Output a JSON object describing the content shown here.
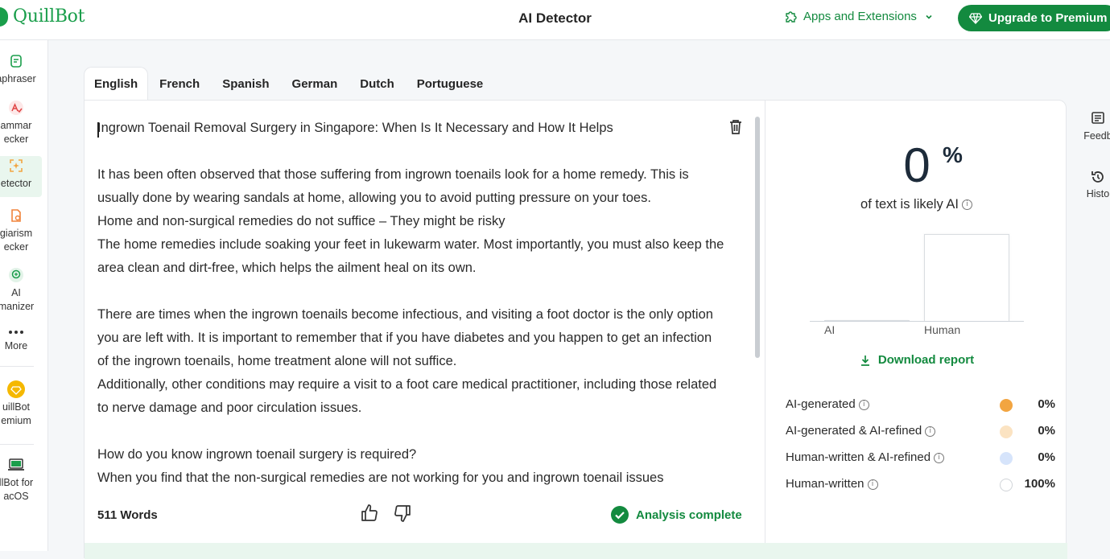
{
  "header": {
    "logo_text": "QuillBot",
    "title": "AI Detector",
    "apps_label": "Apps and Extensions",
    "upgrade_label": "Upgrade to Premium"
  },
  "sidebar": {
    "items": [
      {
        "label": "Paraphraser",
        "visible_label": "aphraser",
        "icon": "paraphraser-icon"
      },
      {
        "label": "Grammar Checker",
        "visible_label": "ammar\necker",
        "icon": "grammar-icon"
      },
      {
        "label": "AI Detector",
        "visible_label": "etector",
        "icon": "detector-icon",
        "active": true
      },
      {
        "label": "Plagiarism Checker",
        "visible_label": "giarism\necker",
        "icon": "plagiarism-icon"
      },
      {
        "label": "AI Humanizer",
        "visible_label": "AI\nmanizer",
        "icon": "humanizer-icon"
      },
      {
        "label": "More",
        "visible_label": "More",
        "icon": "more-icon"
      },
      {
        "label": "QuillBot Premium",
        "visible_label": "uillBot\nemium",
        "icon": "premium-diamond-icon"
      },
      {
        "label": "QuillBot for macOS",
        "visible_label": "llBot for\nacOS",
        "icon": "laptop-icon"
      }
    ]
  },
  "right_rail": {
    "items": [
      {
        "label": "Feedb",
        "icon": "feedback-icon"
      },
      {
        "label": "Histo",
        "icon": "history-icon"
      }
    ]
  },
  "tabs": [
    "English",
    "French",
    "Spanish",
    "German",
    "Dutch",
    "Portuguese"
  ],
  "active_tab": "English",
  "editor": {
    "text": "Ingrown Toenail Removal Surgery in Singapore: When Is It Necessary and How It Helps\n\nIt has been often observed that those suffering from ingrown toenails look for a home remedy. This is usually done by wearing sandals at home, allowing you to avoid putting pressure on your toes.\nHome and non-surgical remedies do not suffice – They might be risky\nThe home remedies include soaking your feet in lukewarm water. Most importantly, you must also keep the area clean and dirt-free, which helps the ailment heal on its own.\n\nThere are times when the ingrown toenails become infectious, and visiting a foot doctor is the only option you are left with. It is important to remember that if you have diabetes and you happen to get an infection of the ingrown toenails, home treatment alone will not suffice.\nAdditionally, other conditions may require a visit to a foot care medical practitioner, including those related to nerve damage and poor circulation issues.\n\nHow do you know ingrown toenail surgery is required?\nWhen you find that the non-surgical remedies are not working for you and ingrown toenail issues",
    "word_count": "511 Words",
    "status": "Analysis complete"
  },
  "results": {
    "percent": "0",
    "percent_sign": "%",
    "subtitle": "of text is likely AI",
    "chart_labels": [
      "AI",
      "Human"
    ],
    "ai_fraction": 0,
    "human_fraction": 1,
    "download_label": "Download report",
    "legend": [
      {
        "name": "AI-generated",
        "value": "0%",
        "color": "#f2a541"
      },
      {
        "name": "AI-generated & AI-refined",
        "value": "0%",
        "color": "#fbe3c2"
      },
      {
        "name": "Human-written & AI-refined",
        "value": "0%",
        "color": "#d6e4fb"
      },
      {
        "name": "Human-written",
        "value": "100%",
        "color": "#ffffff"
      }
    ]
  },
  "colors": {
    "brand": "#138a3f",
    "accent_light": "#e9f6ee"
  }
}
